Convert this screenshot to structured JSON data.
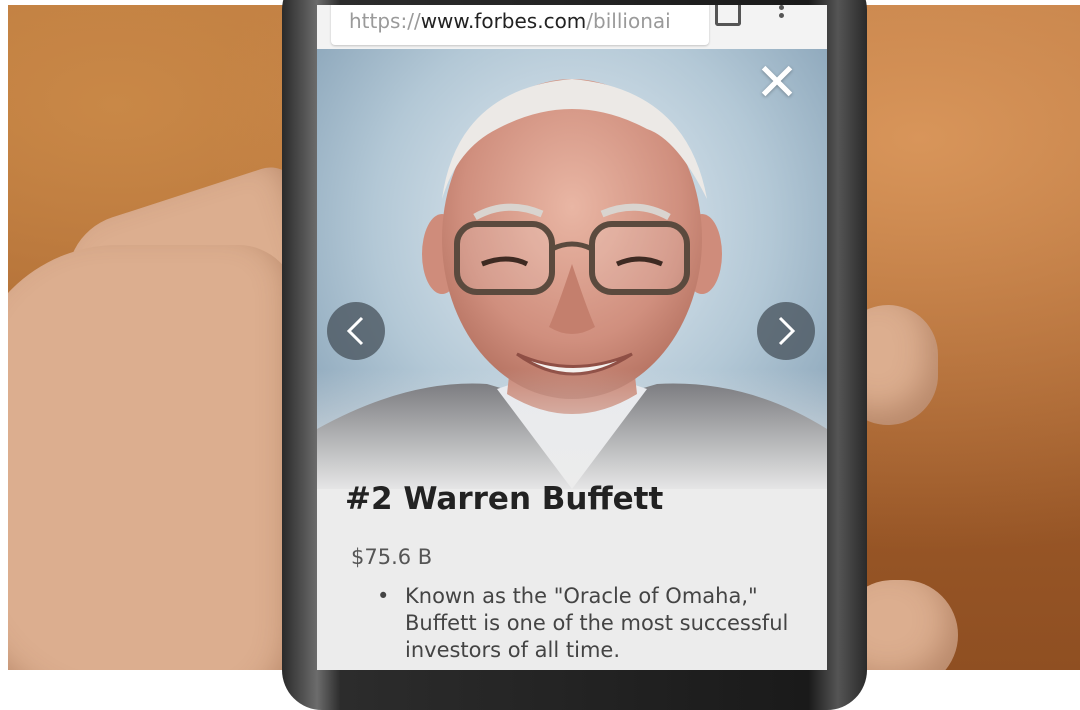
{
  "browser": {
    "url_scheme": "https://",
    "url_host": "www.forbes.com",
    "url_path": "/billionai"
  },
  "profile": {
    "heading": "#2 Warren Buffett",
    "net_worth": "$75.6 B",
    "bullet": "Known as the \"Oracle of Omaha,\" Buffett is one of the most successful investors of all time."
  },
  "controls": {
    "close_glyph": "✕",
    "prev_icon": "chevron-left-icon",
    "next_icon": "chevron-right-icon"
  },
  "colors": {
    "background_blur": "#a35f2c",
    "arrow_fill": "#46505a",
    "heading_text": "#222222"
  }
}
